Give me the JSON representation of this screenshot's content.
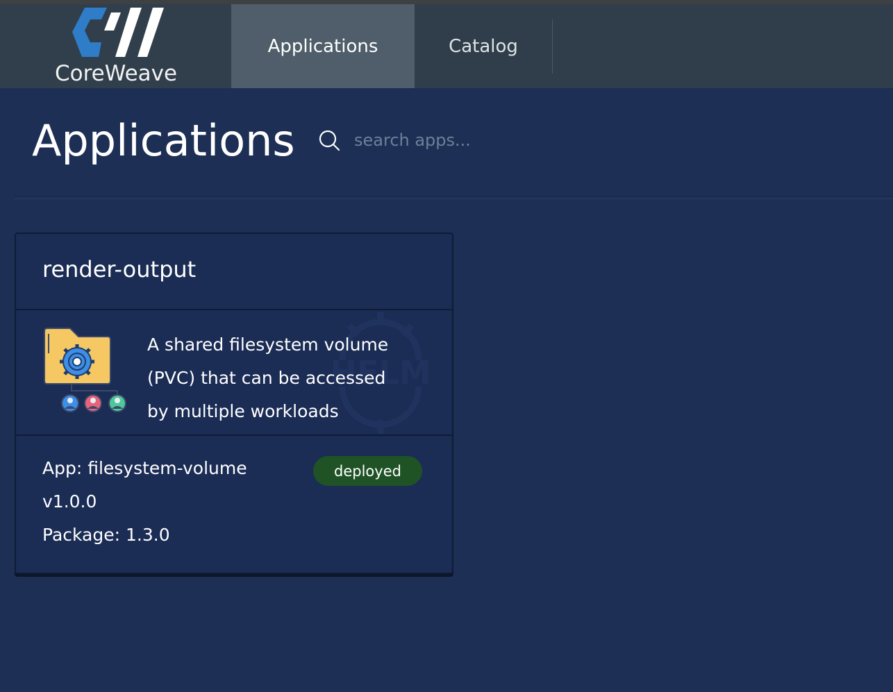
{
  "brand": {
    "name": "CoreWeave"
  },
  "nav": {
    "tabs": [
      {
        "label": "Applications"
      },
      {
        "label": "Catalog"
      }
    ]
  },
  "page": {
    "title": "Applications"
  },
  "search": {
    "placeholder": "search apps..."
  },
  "card": {
    "title": "render-output",
    "description_lines": [
      "A shared filesystem volume",
      "(PVC) that can be accessed",
      "by multiple workloads"
    ],
    "app_line": "App: filesystem-volume",
    "version": "v1.0.0",
    "package": "Package: 1.3.0",
    "status": "deployed",
    "watermark": "HELM"
  },
  "colors": {
    "background": "#1d2f55",
    "header": "#2f3e4a",
    "active_tab": "#4f5e6a",
    "brand_blue": "#2f7dc8",
    "status_green": "#1f5325"
  },
  "icons": [
    "search-icon",
    "coreweave-logo",
    "folder-gear-icon",
    "user-avatar-icon",
    "helm-icon"
  ]
}
